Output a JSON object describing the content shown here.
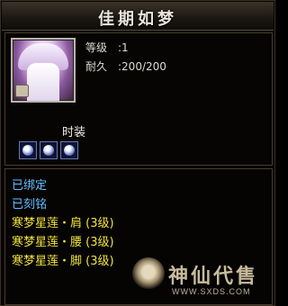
{
  "item": {
    "name": "佳期如梦",
    "stats": [
      {
        "label": "等级",
        "value": ":1"
      },
      {
        "label": "耐久",
        "value": ":200/200"
      }
    ],
    "section_label": "时装",
    "sockets": [
      "white-gem-icon",
      "white-gem-icon",
      "white-gem-icon"
    ],
    "properties": {
      "bound": "已绑定",
      "engraved": "已刻铭",
      "set_pieces": [
        "寒梦星莲・肩 (3级)",
        "寒梦星莲・腰 (3级)",
        "寒梦星莲・脚 (3级)"
      ]
    }
  },
  "watermark": {
    "text": "神仙代售",
    "url": "WWW.SXDS.COM"
  },
  "colors": {
    "bound_text": "#62bfff",
    "set_text": "#f2e33a",
    "title_text": "#eae4da"
  }
}
